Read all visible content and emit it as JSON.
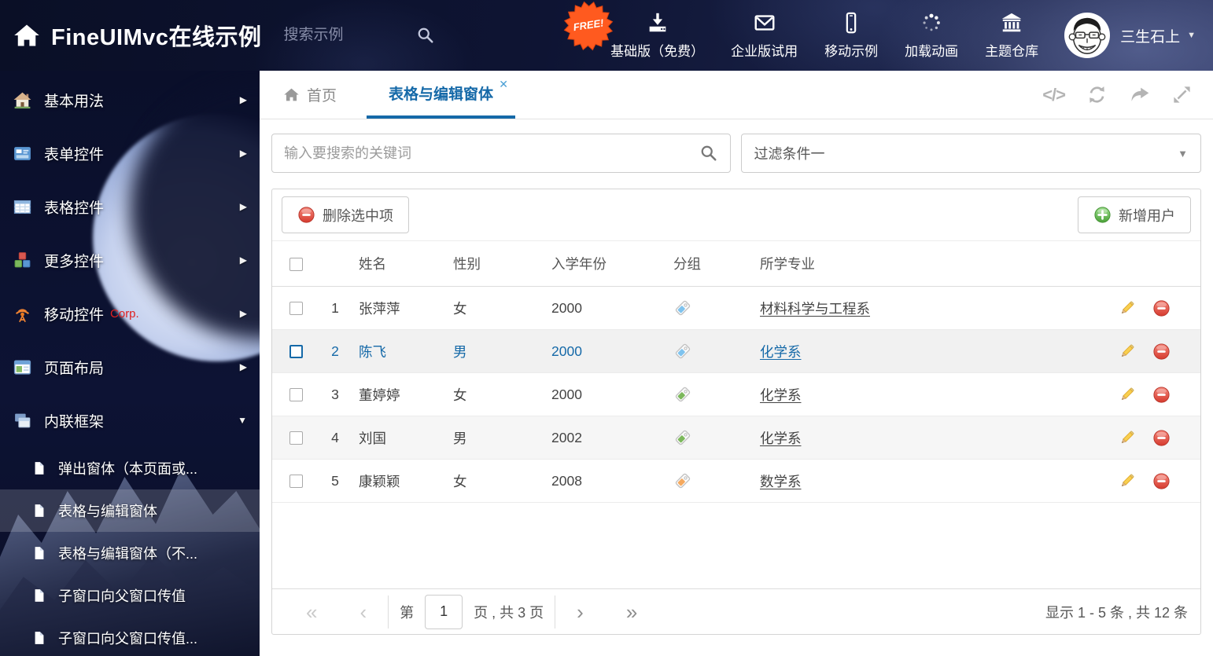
{
  "header": {
    "title": "FineUIMvc在线示例",
    "search_placeholder": "搜索示例",
    "free_badge": "FREE!",
    "nav_items": [
      {
        "slug": "basic-free",
        "icon": "download",
        "label": "基础版（免费）",
        "free": true
      },
      {
        "slug": "enterprise-trial",
        "icon": "envelope",
        "label": "企业版试用"
      },
      {
        "slug": "mobile-demo",
        "icon": "mobile",
        "label": "移动示例"
      },
      {
        "slug": "loading-anim",
        "icon": "spinner",
        "label": "加载动画"
      },
      {
        "slug": "theme-repo",
        "icon": "bank",
        "label": "主题仓库"
      }
    ],
    "username": "三生石上"
  },
  "sidebar": {
    "items": [
      {
        "slug": "basic-usage",
        "icon": "home",
        "label": "基本用法"
      },
      {
        "slug": "form-controls",
        "icon": "form",
        "label": "表单控件"
      },
      {
        "slug": "grid-controls",
        "icon": "grid",
        "label": "表格控件"
      },
      {
        "slug": "more-controls",
        "icon": "cubes",
        "label": "更多控件"
      },
      {
        "slug": "mobile-controls",
        "icon": "antenna",
        "label": "移动控件",
        "badge": "Corp."
      },
      {
        "slug": "page-layout",
        "icon": "layout",
        "label": "页面布局"
      },
      {
        "slug": "inline-frame",
        "icon": "frames",
        "label": "内联框架",
        "expanded": true
      }
    ],
    "subitems": [
      {
        "slug": "popup-window",
        "label": "弹出窗体（本页面或..."
      },
      {
        "slug": "grid-edit-window",
        "label": "表格与编辑窗体",
        "selected": true
      },
      {
        "slug": "grid-edit-window-nopostback",
        "label": "表格与编辑窗体（不..."
      },
      {
        "slug": "child-to-parent",
        "label": "子窗口向父窗口传值"
      },
      {
        "slug": "child-to-parent-2",
        "label": "子窗口向父窗口传值..."
      }
    ]
  },
  "tabs": {
    "home": "首页",
    "active": "表格与编辑窗体"
  },
  "filters": {
    "search_placeholder": "输入要搜索的关键词",
    "filter_value": "过滤条件一"
  },
  "toolbar": {
    "delete_label": "删除选中项",
    "add_label": "新增用户"
  },
  "table": {
    "columns": [
      "姓名",
      "性别",
      "入学年份",
      "分组",
      "所学专业"
    ],
    "rows": [
      {
        "num": "1",
        "name": "张萍萍",
        "gender": "女",
        "year": "2000",
        "tag": "blue",
        "major": "材料科学与工程系",
        "selected": false
      },
      {
        "num": "2",
        "name": "陈飞",
        "gender": "男",
        "year": "2000",
        "tag": "blue",
        "major": "化学系",
        "selected": true
      },
      {
        "num": "3",
        "name": "董婷婷",
        "gender": "女",
        "year": "2000",
        "tag": "green",
        "major": "化学系",
        "selected": false
      },
      {
        "num": "4",
        "name": "刘国",
        "gender": "男",
        "year": "2002",
        "tag": "green",
        "major": "化学系",
        "selected": false
      },
      {
        "num": "5",
        "name": "康颖颖",
        "gender": "女",
        "year": "2008",
        "tag": "orange",
        "major": "数学系",
        "selected": false
      }
    ]
  },
  "pagination": {
    "first": "«",
    "prev": "‹",
    "next": "›",
    "last": "»",
    "page_prefix": "第",
    "page_value": "1",
    "page_suffix": "页 , 共 3 页",
    "summary": "显示 1 - 5 条 , 共 12 条"
  },
  "glyphs": {
    "caret_right": "▶",
    "caret_down": "▼",
    "close": "✕",
    "dropdown_caret": "▼",
    "user_caret": "▼",
    "code": "</>"
  },
  "colors": {
    "accent": "#1569a8",
    "tag_blue": "#7fc3ee",
    "tag_green": "#7cb85c",
    "tag_orange": "#f5a95e",
    "corp": "#e02020",
    "free_badge": "#ff5a1f",
    "delete_red": "#e25146",
    "add_green": "#55b14b"
  }
}
